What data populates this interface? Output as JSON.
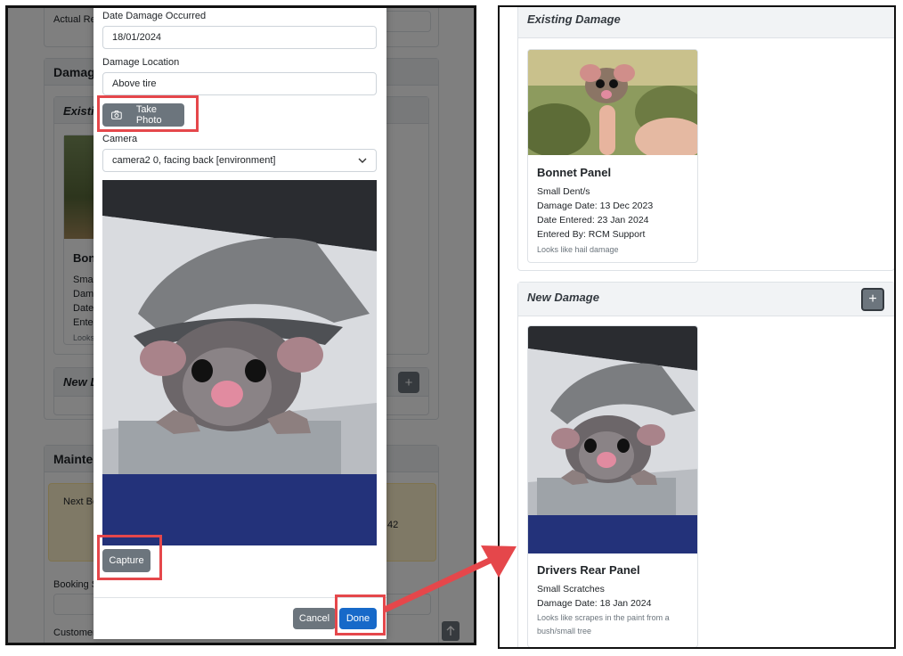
{
  "background_app": {
    "actual_return_label": "Actual Re",
    "damage_section_title": "Damage",
    "existing_header": "Existi",
    "item_title": "Bon",
    "item_lines": [
      "Smal",
      "Dama",
      "Date",
      "Enter"
    ],
    "item_note": "Looks",
    "new_header": "New D",
    "plus_label": "+",
    "maintenance_title": "Mainten",
    "next_booking_label": "Next Bo",
    "next_booking_value": "42",
    "booking_label": "Booking S",
    "customer_label": "Customer"
  },
  "modal": {
    "date_label": "Date Damage Occurred",
    "date_value": "18/01/2024",
    "location_label": "Damage Location",
    "location_value": "Above tire",
    "take_photo_label": "Take Photo",
    "camera_label": "Camera",
    "camera_value": "camera2 0, facing back [environment]",
    "capture_label": "Capture",
    "cancel_label": "Cancel",
    "done_label": "Done"
  },
  "right": {
    "existing_header": "Existing Damage",
    "existing_item": {
      "title": "Bonnet Panel",
      "type": "Small Dent/s",
      "damage_date": "Damage Date: 13 Dec 2023",
      "date_entered": "Date Entered: 23 Jan 2024",
      "entered_by": "Entered By: RCM Support",
      "note": "Looks like hail damage"
    },
    "new_header": "New Damage",
    "add_label": "+",
    "new_item": {
      "title": "Drivers Rear Panel",
      "type": "Small Scratches",
      "damage_date": "Damage Date: 18 Jan 2024",
      "note": "Looks like scrapes in the paint from a bush/small tree"
    }
  },
  "icons": {
    "camera": "camera-icon",
    "chevron": "chevron-down-icon",
    "plus": "plus-icon",
    "scroll_top": "arrow-up-icon"
  },
  "colors": {
    "primary": "#1769c9",
    "secondary": "#6c757d",
    "highlight": "#e5474b",
    "warning_bg": "#fff3cd"
  }
}
